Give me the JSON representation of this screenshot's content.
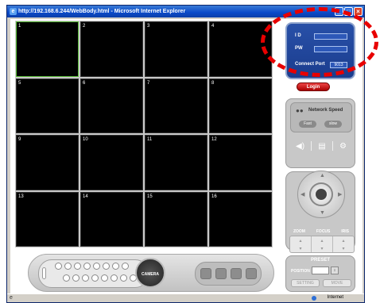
{
  "window": {
    "title": "http://192.168.6.244/WebBody.html - Microsoft Internet Explorer"
  },
  "channels": [
    "1",
    "2",
    "3",
    "4",
    "5",
    "6",
    "7",
    "8",
    "9",
    "10",
    "11",
    "12",
    "13",
    "14",
    "15",
    "16"
  ],
  "login": {
    "id_label": "I D",
    "pw_label": "PW",
    "port_label": "Connect Port",
    "port_value": "9013",
    "button": "Login"
  },
  "network": {
    "title": "Network Speed",
    "fast": "Fast",
    "slow": "slow"
  },
  "ptz": {
    "zoom": "ZOOM",
    "focus": "FOCUS",
    "iris": "IRIS"
  },
  "preset": {
    "title": "PRESET",
    "position_label": "POSITION",
    "setting": "SETTING",
    "move": "MOVE"
  },
  "camera_button": "CAMERA",
  "status": {
    "zone": "Internet"
  },
  "colors": {
    "titlebar": "#0a49c9",
    "login_panel": "#1b3d8e",
    "highlight_ellipse": "#e80000"
  }
}
